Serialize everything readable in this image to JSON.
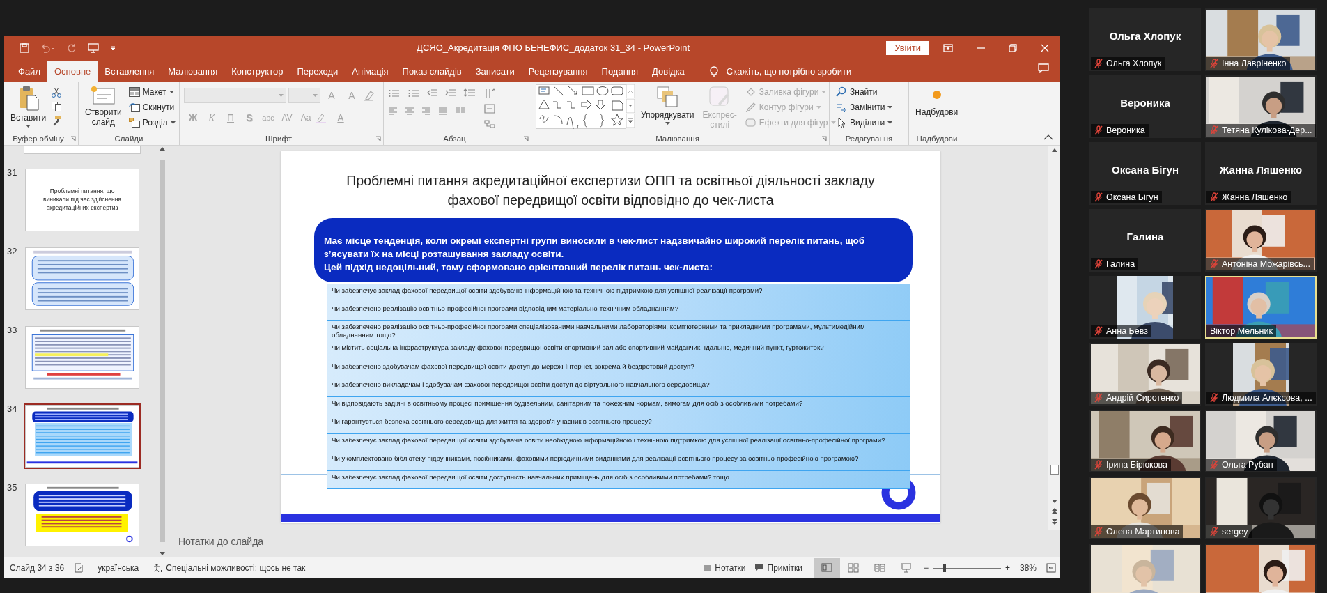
{
  "window": {
    "title": "ДСЯО_Акредитація ФПО БЕНЕФИС_додаток 31_34  -  PowerPoint",
    "sign_in": "Увійти"
  },
  "tabs": [
    {
      "label": "Файл",
      "selected": false
    },
    {
      "label": "Основне",
      "selected": true
    },
    {
      "label": "Вставлення",
      "selected": false
    },
    {
      "label": "Малювання",
      "selected": false
    },
    {
      "label": "Конструктор",
      "selected": false
    },
    {
      "label": "Переходи",
      "selected": false
    },
    {
      "label": "Анімація",
      "selected": false
    },
    {
      "label": "Показ слайдів",
      "selected": false
    },
    {
      "label": "Записати",
      "selected": false
    },
    {
      "label": "Рецензування",
      "selected": false
    },
    {
      "label": "Подання",
      "selected": false
    },
    {
      "label": "Довідка",
      "selected": false
    }
  ],
  "tell_me": {
    "placeholder": "Скажіть, що потрібно зробити"
  },
  "ribbon": {
    "clipboard": {
      "paste": "Вставити",
      "label": "Буфер обміну"
    },
    "slides": {
      "new_slide": "Створити слайд",
      "commands": [
        "Макет",
        "Скинути",
        "Розділ"
      ],
      "label": "Слайди"
    },
    "font": {
      "disabled": true,
      "size_buttons": [
        "A",
        "A"
      ],
      "format_buttons": [
        "Ж",
        "К",
        "П",
        "S",
        "abc",
        "AV",
        "Aa"
      ],
      "color_button": "A",
      "label": "Шрифт"
    },
    "paragraph": {
      "label": "Абзац"
    },
    "drawing": {
      "arrange": "Упорядкувати",
      "quick_styles": {
        "label": "Експрес-стилі",
        "disabled": true
      },
      "commands": [
        {
          "label": "Заливка фігури",
          "disabled": true
        },
        {
          "label": "Контур фігури",
          "disabled": true
        },
        {
          "label": "Ефекти для фігур",
          "disabled": true
        }
      ],
      "label": "Малювання"
    },
    "editing": {
      "commands": [
        "Знайти",
        "Замінити",
        "Виділити"
      ],
      "label": "Редагування"
    },
    "addins": {
      "button": "Надбудови",
      "label": "Надбудови"
    }
  },
  "thumbnails": [
    {
      "number": "31",
      "kind": "title",
      "text": "Проблемні питання, що виникали під час здійснення акредитаційних експертиз",
      "selected": false
    },
    {
      "number": "32",
      "kind": "boxes",
      "selected": false
    },
    {
      "number": "33",
      "kind": "list",
      "selected": false
    },
    {
      "number": "34",
      "kind": "checklist",
      "selected": true
    },
    {
      "number": "35",
      "kind": "mixed",
      "selected": false
    }
  ],
  "slide": {
    "title": "Проблемні питання акредитаційної експертизи ОПП та освітньої діяльності закладу фахової передвищої освіти відповідно до чек-листа",
    "intro": [
      "Має місце тенденція, коли окремі експертні групи виносили в чек-лист надзвичайно широкий перелік питань, щоб з’ясувати їх на місці розташування закладу освіти.",
      "Цей підхід недоцільний, тому сформовано орієнтовний перелік питань чек-листа:"
    ],
    "questions": [
      "Чи забезпечує заклад фахової передвищої освіти здобувачів інформаційною та технічною підтримкою для успішної реалізації програми?",
      "Чи забезпечено реалізацію освітньо-професійної програми відповідним матеріально-технічним обладнанням?",
      "Чи забезпечено реалізацію освітньо-професійної програми спеціалізованими навчальними лабораторіями, комп’ютерними та прикладними програмами, мультимедійним обладнанням тощо?",
      "Чи містить соціальна інфраструктура закладу фахової передвищої освіти спортивний зал або спортивний майданчик, їдальню, медичний пункт, гуртожиток?",
      "Чи забезпечено здобувачам фахової передвищої освіти доступ до мережі Інтернет, зокрема й бездротовий доступ?",
      "Чи забезпечено викладачам і здобувачам фахової передвищої освіти доступ до віртуального навчального середовища?",
      "Чи відповідають задіяні в освітньому процесі приміщення будівельним, санітарним та пожежним нормам, вимогам для осіб з особливими потребами?",
      "Чи гарантується безпека освітнього середовища для життя та здоров’я учасників освітнього процесу?",
      "Чи забезпечує заклад фахової передвищої освіти здобувачів освіти необхідною інформаційною і технічною підтримкою для успішної реалізації освітньо-професійної програми?",
      "Чи укомплектовано бібліотеку підручниками, посібниками, фаховими періодичними виданнями для реалізації освітнього процесу за освітньо-професійною програмою?",
      "Чи забезпечує заклад фахової передвищої освіти доступність навчальних приміщень для осіб з особливими потребами? тощо"
    ]
  },
  "notes": {
    "placeholder": "Нотатки до слайда"
  },
  "status_bar": {
    "slide": "Слайд 34 з 36",
    "language": "українська",
    "accessibility": "Спеціальні можливості: щось не так",
    "notes": "Нотатки",
    "comments": "Примітки",
    "views": [
      {
        "kind": "normal",
        "selected": true
      },
      {
        "kind": "sorter",
        "selected": false
      },
      {
        "kind": "reading",
        "selected": false
      },
      {
        "kind": "show",
        "selected": false
      }
    ],
    "zoom": {
      "out": "−",
      "in": "+",
      "level": 0.17,
      "percent": "38%"
    }
  },
  "participants": [
    {
      "kind": "name",
      "name": "Ольга Хлопук",
      "label": "Ольга Хлопук",
      "muted": true,
      "speaking": false
    },
    {
      "kind": "video",
      "label": "Інна Лавріненко",
      "muted": true,
      "speaking": false
    },
    {
      "kind": "name",
      "name": "Вероника",
      "label": "Вероника",
      "muted": true,
      "speaking": false
    },
    {
      "kind": "video",
      "label": "Тетяна Кулікова-Дер...",
      "muted": true,
      "speaking": false
    },
    {
      "kind": "name",
      "name": "Оксана Бігун",
      "label": "Оксана Бігун",
      "muted": true,
      "speaking": false
    },
    {
      "kind": "name",
      "name": "Жанна Ляшенко",
      "label": "Жанна Ляшенко",
      "muted": true,
      "speaking": false
    },
    {
      "kind": "name",
      "name": "Галина",
      "label": "Галина",
      "muted": true,
      "speaking": false
    },
    {
      "kind": "video",
      "label": "Антоніна Можарівсь...",
      "muted": true,
      "speaking": false
    },
    {
      "kind": "avatar",
      "label": "Анна Бевз",
      "muted": true,
      "speaking": false
    },
    {
      "kind": "video",
      "label": "Віктор Мельник",
      "muted": false,
      "speaking": true
    },
    {
      "kind": "video",
      "label": "Андрій Сиротенко",
      "muted": true,
      "speaking": false
    },
    {
      "kind": "avatar",
      "label": "Людмила Алєксова, ...",
      "muted": true,
      "speaking": false
    },
    {
      "kind": "video",
      "label": "Ірина Бірюкова",
      "muted": true,
      "speaking": false
    },
    {
      "kind": "video",
      "label": "Ольга Рубан",
      "muted": true,
      "speaking": false
    },
    {
      "kind": "video",
      "label": "Олена Мартинова",
      "muted": true,
      "speaking": false
    },
    {
      "kind": "video",
      "label": "sergey",
      "muted": true,
      "speaking": false
    },
    {
      "kind": "video",
      "speaking": false
    },
    {
      "kind": "video",
      "speaking": false
    }
  ]
}
